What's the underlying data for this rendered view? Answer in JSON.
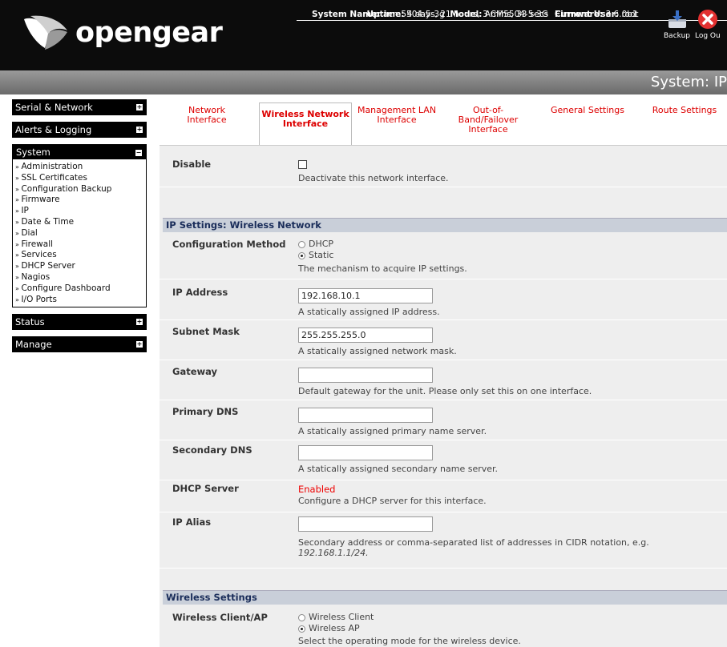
{
  "header": {
    "logo_text": "opengear",
    "system_name_label": "System Name:",
    "system_name": "acm5504-5-3g",
    "model_label": "Model:",
    "model": "ACM5504-5-3G",
    "firmware_label": "Firmware:",
    "firmware": "3.6.0b1",
    "uptime_label": "Uptime:",
    "uptime": "4 days, 21 hours, 3 mins, 33 secs",
    "current_user_label": "Current User:",
    "current_user": "root",
    "backup_label": "Backup",
    "logout_label": "Log Ou"
  },
  "page_title": "System: IP",
  "sidebar": {
    "serial_network": "Serial & Network",
    "alerts_logging": "Alerts & Logging",
    "system": "System",
    "system_items": [
      "Administration",
      "SSL Certificates",
      "Configuration Backup",
      "Firmware",
      "IP",
      "Date & Time",
      "Dial",
      "Firewall",
      "Services",
      "DHCP Server",
      "Nagios",
      "Configure Dashboard",
      "I/O Ports"
    ],
    "status": "Status",
    "manage": "Manage",
    "toggle_plus": "+",
    "toggle_minus": "−"
  },
  "tabs": [
    {
      "label": "Network Interface",
      "active": false
    },
    {
      "label": "Wireless Network Interface",
      "active": true
    },
    {
      "label": "Management LAN Interface",
      "active": false
    },
    {
      "label": "Out-of-Band/Failover Interface",
      "active": false
    },
    {
      "label": "General Settings",
      "active": false
    },
    {
      "label": "Route Settings",
      "active": false
    }
  ],
  "form": {
    "disable": {
      "label": "Disable",
      "desc": "Deactivate this network interface."
    },
    "ip_section": "IP Settings: Wireless Network",
    "config_method": {
      "label": "Configuration Method",
      "opt_dhcp": "DHCP",
      "opt_static": "Static",
      "desc": "The mechanism to acquire IP settings."
    },
    "ip_address": {
      "label": "IP Address",
      "value": "192.168.10.1",
      "desc": "A statically assigned IP address."
    },
    "subnet_mask": {
      "label": "Subnet Mask",
      "value": "255.255.255.0",
      "desc": "A statically assigned network mask."
    },
    "gateway": {
      "label": "Gateway",
      "value": "",
      "desc": "Default gateway for the unit. Please only set this on one interface."
    },
    "primary_dns": {
      "label": "Primary DNS",
      "value": "",
      "desc": "A statically assigned primary name server."
    },
    "secondary_dns": {
      "label": "Secondary DNS",
      "value": "",
      "desc": "A statically assigned secondary name server."
    },
    "dhcp_server": {
      "label": "DHCP Server",
      "status": "Enabled",
      "desc": "Configure a DHCP server for this interface."
    },
    "ip_alias": {
      "label": "IP Alias",
      "value": "",
      "desc": "Secondary address or comma-separated list of addresses in CIDR notation, e.g.",
      "example": "192.168.1.1/24."
    },
    "wireless_section": "Wireless Settings",
    "wireless_mode": {
      "label": "Wireless Client/AP",
      "opt_client": "Wireless Client",
      "opt_ap": "Wireless AP",
      "desc": "Select the operating mode for the wireless device."
    }
  },
  "colors": {
    "header_bg": "#0c0c0c",
    "tab_link": "#dd0000",
    "section_bg": "#c9cfd9",
    "content_bg": "#eeeeee",
    "enabled_red": "#ee0000"
  }
}
